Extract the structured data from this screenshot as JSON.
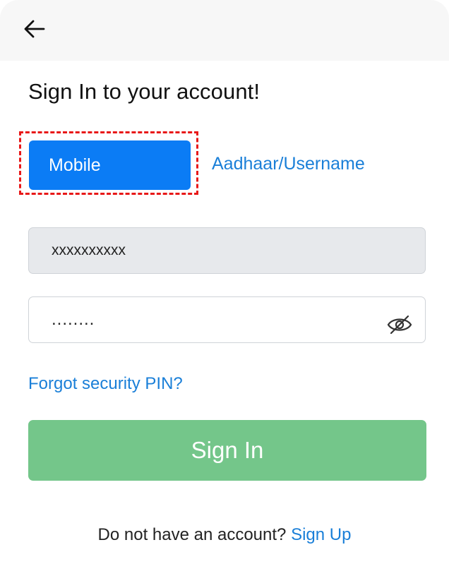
{
  "header": {
    "back_icon": "arrow-left-icon"
  },
  "page": {
    "title": "Sign In to your account!"
  },
  "tabs": [
    {
      "label": "Mobile",
      "selected": true
    },
    {
      "label": "Aadhaar/Username",
      "selected": false
    }
  ],
  "form": {
    "mobile_value": "xxxxxxxxxx",
    "pin_value": "........",
    "pin_toggle_icon": "eye-off-icon"
  },
  "links": {
    "forgot_pin": "Forgot security PIN?"
  },
  "actions": {
    "sign_in_label": "Sign In"
  },
  "footer": {
    "prompt": "Do not have an account?",
    "sign_up_label": "Sign Up"
  },
  "colors": {
    "primary_blue": "#0b7cf5",
    "link_blue": "#1a7fd8",
    "sign_in_green": "#74c68a",
    "highlight_red": "#e81818"
  }
}
